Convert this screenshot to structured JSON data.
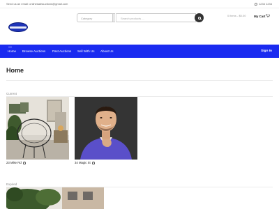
{
  "topbar": {
    "email": "Send us an email: onlinesaleauctions@gmail.com",
    "phone": "1234 1234"
  },
  "search": {
    "category_placeholder": "Category",
    "input_placeholder": "Search products ..."
  },
  "cart": {
    "summary": "0 items - $0.00",
    "label": "My Cart"
  },
  "nav": {
    "items": [
      {
        "label": "Home"
      },
      {
        "label": "Browse Auctions"
      },
      {
        "label": "Past Auctions"
      },
      {
        "label": "Sell With Us"
      },
      {
        "label": "About Us"
      }
    ],
    "sign_in": "Sign In"
  },
  "page": {
    "title": "Home"
  },
  "sections": {
    "current": {
      "label": "Current",
      "cards": [
        {
          "caption": "23 Mike Rd"
        },
        {
          "caption": "34 Magic St"
        }
      ]
    },
    "expired": {
      "label": "Expired"
    }
  },
  "colors": {
    "nav_bg": "#1a2bf0",
    "accent": "#1e34b8"
  }
}
